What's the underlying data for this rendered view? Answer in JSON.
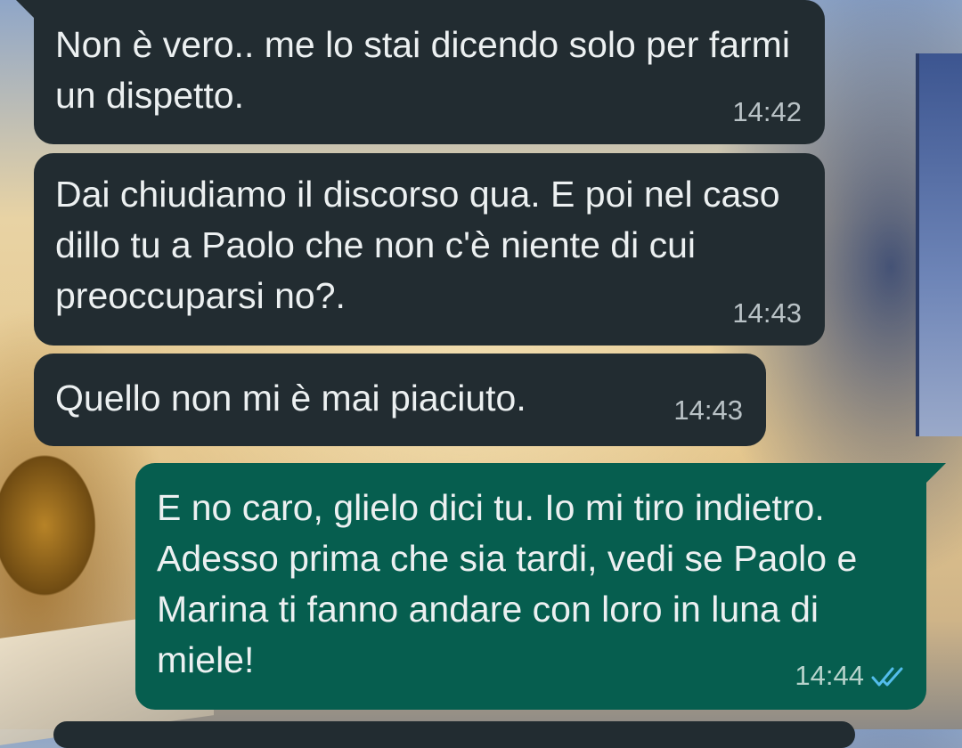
{
  "messages": [
    {
      "direction": "incoming",
      "text": "Non è vero..  me lo stai dicendo solo per farmi un dispetto.",
      "time": "14:42"
    },
    {
      "direction": "incoming",
      "text": "Dai chiudiamo il discorso qua. E poi nel caso dillo tu a Paolo che non c'è niente di cui preoccuparsi no?.",
      "time": "14:43"
    },
    {
      "direction": "incoming",
      "text": "Quello non mi è mai piaciuto.",
      "time": "14:43"
    },
    {
      "direction": "outgoing",
      "text": "E no caro, glielo dici tu. Io mi tiro indietro. Adesso prima che sia tardi, vedi se Paolo e Marina ti fanno andare con loro in luna di miele!",
      "time": "14:44",
      "status": "read-double-check-icon"
    }
  ],
  "colors": {
    "incoming_bubble": "#222c31",
    "outgoing_bubble": "#065e4f",
    "message_text": "#ecf0f1",
    "read_ticks": "#53bdeb"
  }
}
